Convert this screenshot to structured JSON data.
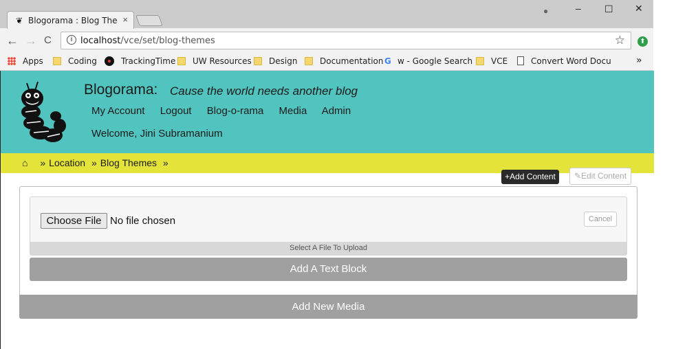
{
  "browser": {
    "tab_title": "Blogorama : Blog Theme",
    "tab_close": "×",
    "url_host": "localhost",
    "url_path": "/vce/set/blog-themes",
    "back": "←",
    "forward": "→",
    "reload": "C",
    "star": "☆",
    "win_min": "–",
    "win_max": "☐",
    "win_close": "✕",
    "profile": "●",
    "bookmarks": {
      "apps": "Apps",
      "coding": "Coding",
      "trackingtime": "TrackingTime",
      "uw": "UW Resources",
      "design": "Design",
      "documentation": "Documentation",
      "google": "w - Google Search",
      "vce": "VCE",
      "convert": "Convert Word Docu",
      "more": "»"
    }
  },
  "site": {
    "name": "Blogorama:",
    "tagline": "Cause the world needs another blog",
    "nav": [
      "My Account",
      "Logout",
      "Blog-o-rama",
      "Media",
      "Admin"
    ],
    "welcome": "Welcome, Jini Subramanium"
  },
  "breadcrumb": {
    "home_icon": "⌂",
    "sep": "»",
    "items": [
      "Location",
      "Blog Themes"
    ]
  },
  "actions": {
    "add_content": "+Add Content",
    "edit_content": "✎Edit Content"
  },
  "upload": {
    "choose_label": "Choose File",
    "no_file": "No file chosen",
    "cancel": "Cancel",
    "hint": "Select A File To Upload"
  },
  "buttons": {
    "add_text_block": "Add A Text Block",
    "add_new_media": "Add New Media"
  }
}
